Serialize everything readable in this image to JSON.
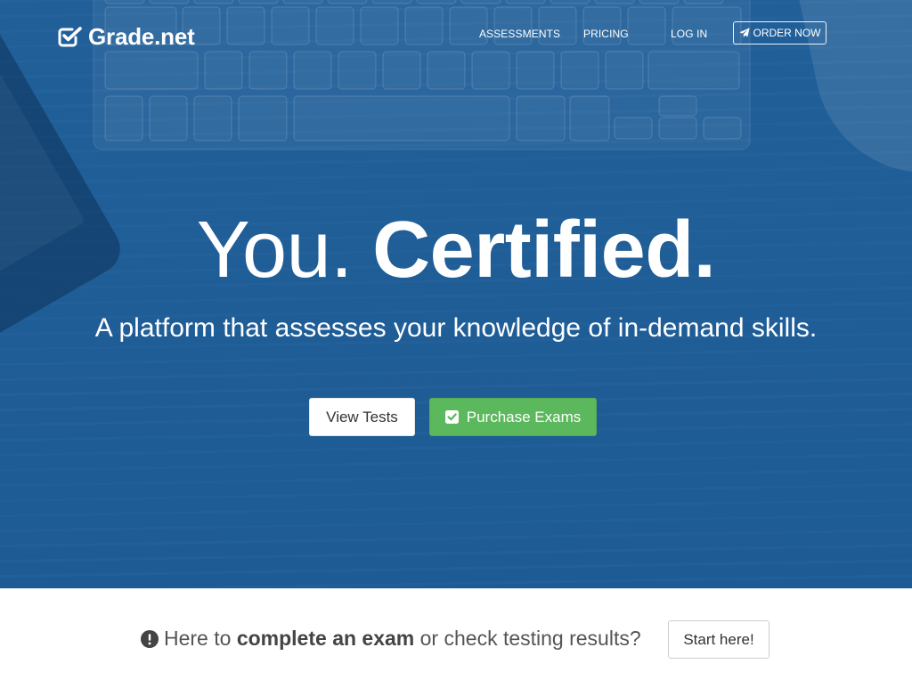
{
  "nav": {
    "logo": "Grade.net",
    "links": {
      "assessments": "ASSESSMENTS",
      "pricing": "PRICING",
      "login": "LOG IN"
    },
    "order_now": "ORDER NOW"
  },
  "hero": {
    "headline_light": "You.",
    "headline_bold": "Certified.",
    "subtitle": "A platform that assesses your knowledge of in-demand skills.",
    "view_tests": "View Tests",
    "purchase_exams": "Purchase Exams"
  },
  "exam_prompt": {
    "before": "Here to ",
    "bold": "complete an exam",
    "after": " or check testing results?",
    "start_button": "Start here!"
  },
  "icons": {
    "logo": "checkbox-checked-icon",
    "order_now": "paper-plane-icon",
    "purchase_exams": "checkbox-checked-icon",
    "exam_prompt": "exclamation-circle-icon"
  },
  "colors": {
    "hero_background": "#1f5d97",
    "purchase_button": "#5cb85c",
    "hero_text": "#ffffff",
    "prompt_text": "#555555"
  }
}
